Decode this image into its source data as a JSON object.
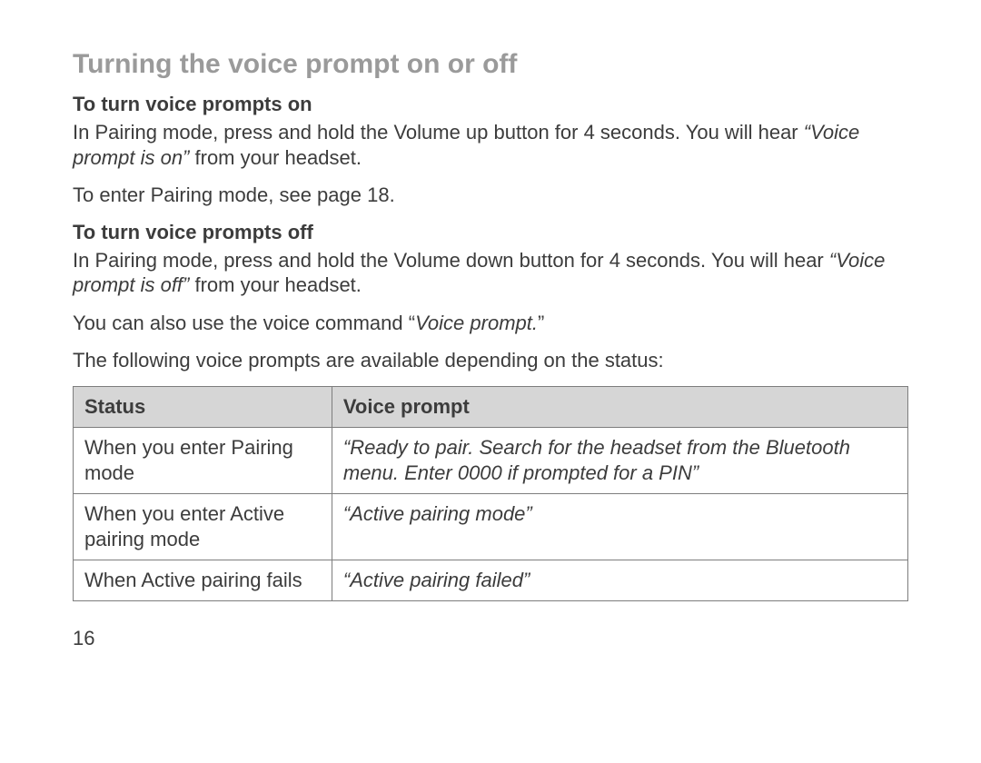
{
  "title": "Turning the voice prompt on or off",
  "on": {
    "heading": "To turn voice prompts on",
    "p1_a": "In Pairing mode, press and hold the Volume up button for 4 seconds. You will hear ",
    "p1_q": "“Voice prompt is on”",
    "p1_b": " from your headset.",
    "p2": "To enter Pairing mode, see page 18."
  },
  "off": {
    "heading": "To turn voice prompts off",
    "p1_a": "In Pairing mode, press and hold the Volume down button for 4 seconds. You will hear ",
    "p1_q": "“Voice prompt is off”",
    "p1_b": " from your headset.",
    "p2_a": "You can also use the voice command “",
    "p2_q": "Voice prompt.",
    "p2_b": "”"
  },
  "intro_table": "The following voice prompts are available depending on the status:",
  "table": {
    "head": {
      "status": "Status",
      "prompt": "Voice prompt"
    },
    "rows": [
      {
        "status": "When you enter Pairing mode",
        "prompt": "“Ready to pair. Search for the headset from the Bluetooth menu. Enter 0000 if prompted for a PIN”"
      },
      {
        "status": "When you enter Active pairing mode",
        "prompt": "“Active pairing mode”"
      },
      {
        "status": "When Active pairing fails",
        "prompt": "“Active pairing failed”"
      }
    ]
  },
  "page_number": "16"
}
